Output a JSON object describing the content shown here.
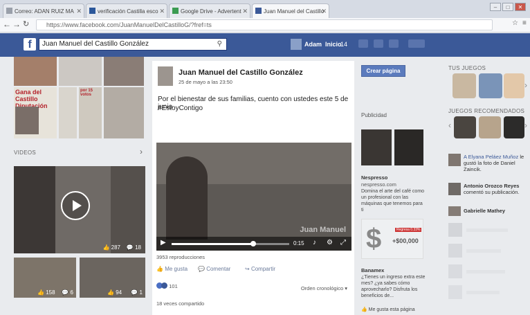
{
  "browser": {
    "tabs": [
      {
        "label": "Correo: ADAN RUIZ MA"
      },
      {
        "label": "verificación Castilla esco"
      },
      {
        "label": "Google Drive - Advertent"
      },
      {
        "label": "Juan Manuel del Castillo"
      }
    ],
    "url": "https://www.facebook.com/JuanManuelDelCastilloG/?fref=ts"
  },
  "fbheader": {
    "search_value": "Juan Manuel del Castillo González",
    "user": "Adam",
    "home": "Inicio",
    "home_count": "14"
  },
  "leftcol": {
    "collage_text": "Gana del Castillo Diputación Local",
    "collage_text2": "por 15 votos",
    "videos_label": "VIDEOS",
    "video_main": {
      "likes": "287",
      "comments": "18"
    },
    "video_small1": {
      "likes": "158",
      "comments": "6"
    },
    "video_small2": {
      "likes": "94",
      "comments": "1"
    }
  },
  "post": {
    "author": "Juan Manuel del Castillo González",
    "date": "25 de mayo a las 23:50",
    "text_line1": "Por el bienestar de sus familias, cuento con ustedes este 5 de junio",
    "hashtag": "#EstoyContigo",
    "video_time": "0:15",
    "watermark": "Juan Manuel",
    "views": "3953 reproducciones",
    "like": "Me gusta",
    "comment": "Comentar",
    "share": "Compartir",
    "reactions_count": "101",
    "order": "Orden cronológico",
    "shares": "18 veces compartido"
  },
  "ads": {
    "create_page": "Crear página",
    "label": "Publicidad",
    "nespresso": {
      "title": "Nespresso",
      "domain": "nespresso.com",
      "text": "Domina el arte del café como un profesional con las máquinas que tenemos para ti"
    },
    "banamex": {
      "badge": "Regresa 0.33%",
      "amount": "+$00,000",
      "title": "Banamex",
      "text": "¿Tienes un ingreso extra este mes? ¿ya sabes cómo aprovecharlo? Disfruta los beneficios de...",
      "footer": "Me gusta esta página"
    }
  },
  "rightcol": {
    "games_label": "TUS JUEGOS",
    "rec_label": "JUEGOS RECOMENDADOS",
    "activity": [
      {
        "name": "A Elyana Peláez Muñoz",
        "text": "le gustó la foto de Daniel Zaincik."
      },
      {
        "name": "Antonio Orozco Reyes",
        "text": "comentó su publicación."
      },
      {
        "name": "Gabrielle Mathey",
        "text": ""
      }
    ]
  }
}
